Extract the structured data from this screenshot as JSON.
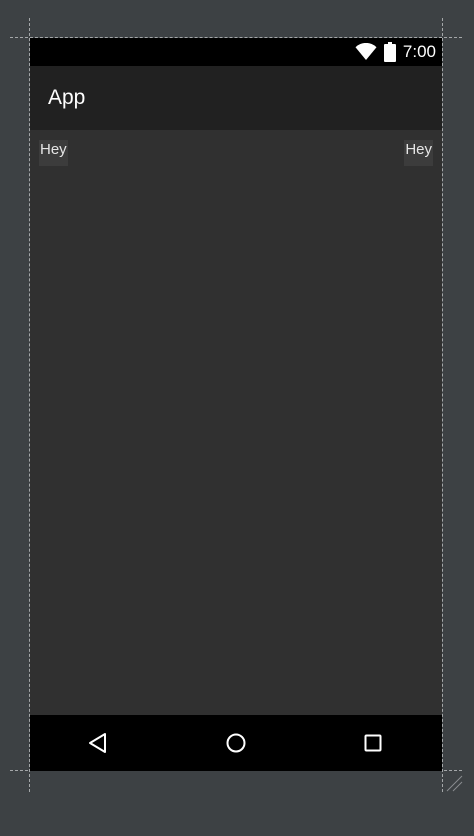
{
  "status_bar": {
    "time": "7:00",
    "icons": [
      "wifi-icon",
      "battery-icon"
    ]
  },
  "app_bar": {
    "title": "App"
  },
  "content": {
    "left_button_label": "Hey",
    "right_button_label": "Hey"
  },
  "navigation_bar": {
    "icons": [
      "back-icon",
      "home-icon",
      "recents-icon"
    ]
  },
  "colors": {
    "canvas_background": "#3d4144",
    "screen_background": "#303030",
    "app_bar": "#212121",
    "system_bars": "#000000",
    "button_background": "#3c3c3c",
    "text": "#ffffff"
  }
}
